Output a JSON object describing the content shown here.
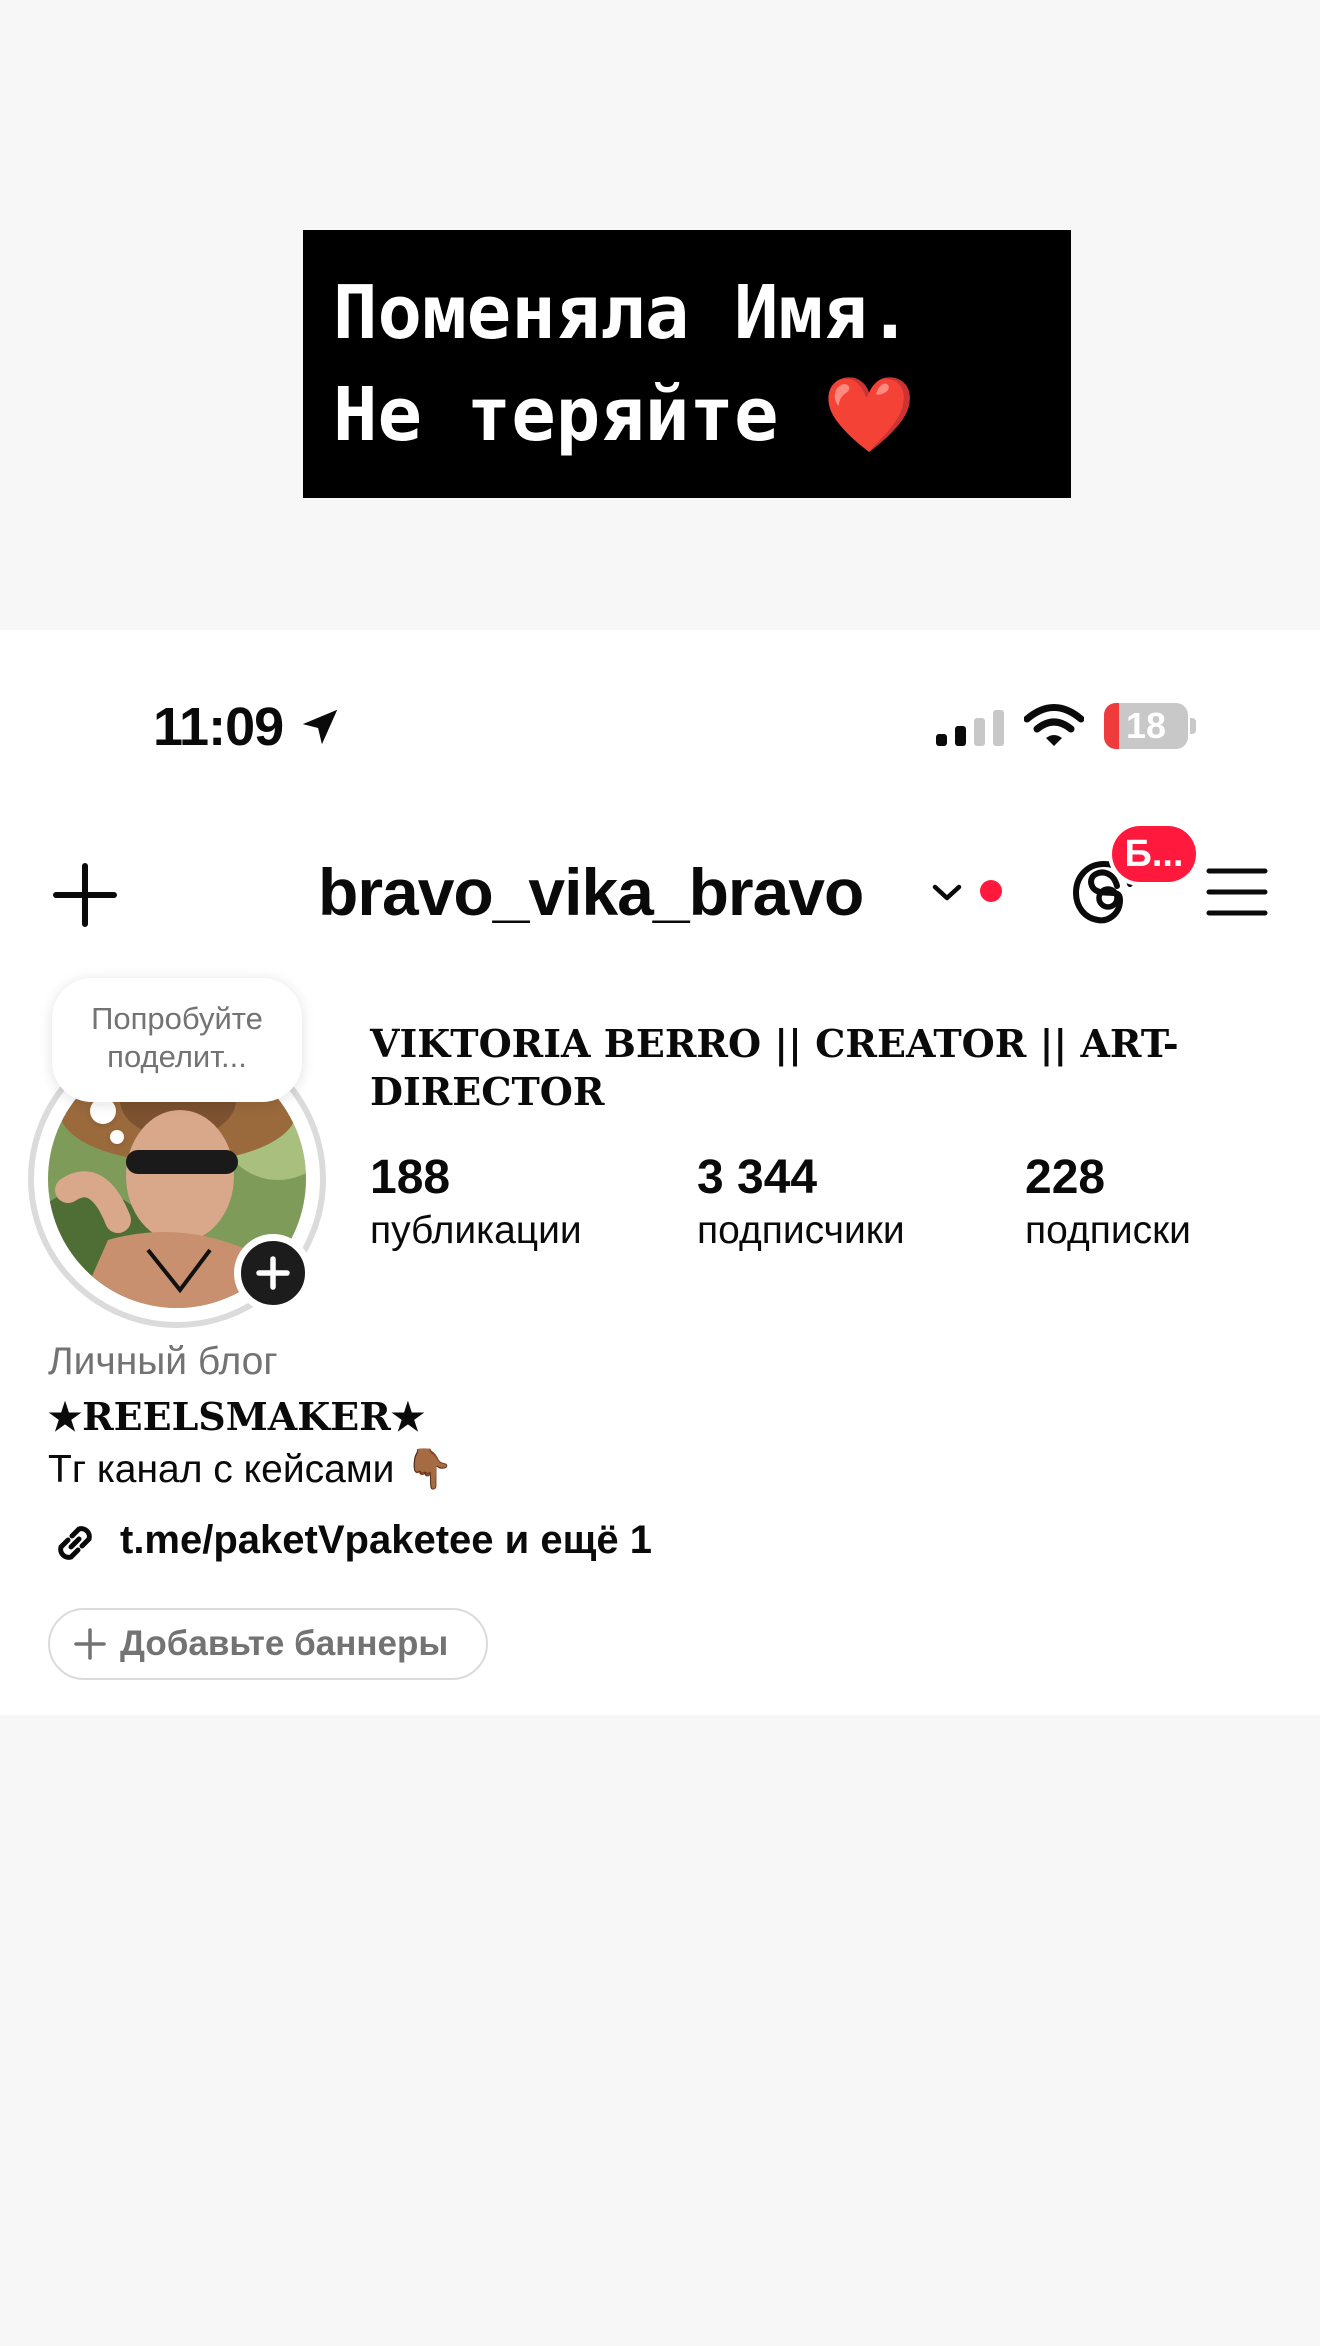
{
  "story_caption": {
    "line1": "Поменяла Имя.",
    "line2": "Не теряйте",
    "emoji": "❤️"
  },
  "status_bar": {
    "time": "11:09",
    "battery_level": "18",
    "battery_fraction": 0.18
  },
  "header": {
    "username": "bravo_vika_bravo",
    "threads_badge": "Б..."
  },
  "profile": {
    "note": "Попробуйте поделит...",
    "display_name": "VIKTORIA BERRO || CREATOR || ART-DIRECTOR",
    "stats": [
      {
        "value": "188",
        "label": "публикации"
      },
      {
        "value": "3 344",
        "label": "подписчики"
      },
      {
        "value": "228",
        "label": "подписки"
      }
    ],
    "category": "Личный блог",
    "bio_title": "★REELSMAKER★",
    "bio_line": "Тг канал с кейсами 👇🏾",
    "link": "t.me/paketVpaketee и ещё 1",
    "banner_button": "Добавьте баннеры"
  },
  "icons": {
    "status": [
      "location-arrow-icon",
      "signal-icon",
      "wifi-icon",
      "battery-icon"
    ],
    "header": [
      "plus-icon",
      "chevron-down-icon",
      "threads-icon",
      "menu-icon"
    ],
    "profile": [
      "add-story-icon",
      "link-icon",
      "plus-icon"
    ]
  },
  "colors": {
    "accent_red": "#ff1a3d",
    "muted_text": "#737373",
    "caption_bg": "#000000"
  }
}
